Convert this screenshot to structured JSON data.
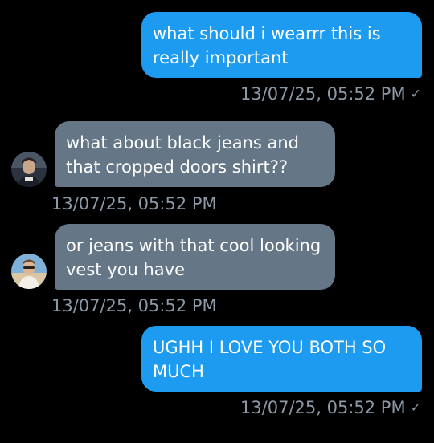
{
  "conversation": {
    "messages": [
      {
        "direction": "sent",
        "text": "what should i wearrr this is really important",
        "timestamp": "13/07/25, 05:52 PM",
        "read_receipt_icon": "checkmark-icon"
      },
      {
        "direction": "received",
        "text": "what about black jeans and that cropped doors shirt??",
        "timestamp": "13/07/25, 05:52 PM",
        "avatar_icon": "avatar-user-1"
      },
      {
        "direction": "received",
        "text": "or jeans with that cool looking vest you have",
        "timestamp": "13/07/25, 05:52 PM",
        "avatar_icon": "avatar-user-2"
      },
      {
        "direction": "sent",
        "text": "UGHH I LOVE YOU BOTH SO MUCH",
        "timestamp": "13/07/25, 05:52 PM",
        "read_receipt_icon": "checkmark-icon"
      }
    ],
    "check_glyph": "✓"
  },
  "colors": {
    "background": "#000000",
    "sent_bubble": "#1d9bf0",
    "received_bubble": "#657786",
    "timestamp": "#8b98a5"
  }
}
